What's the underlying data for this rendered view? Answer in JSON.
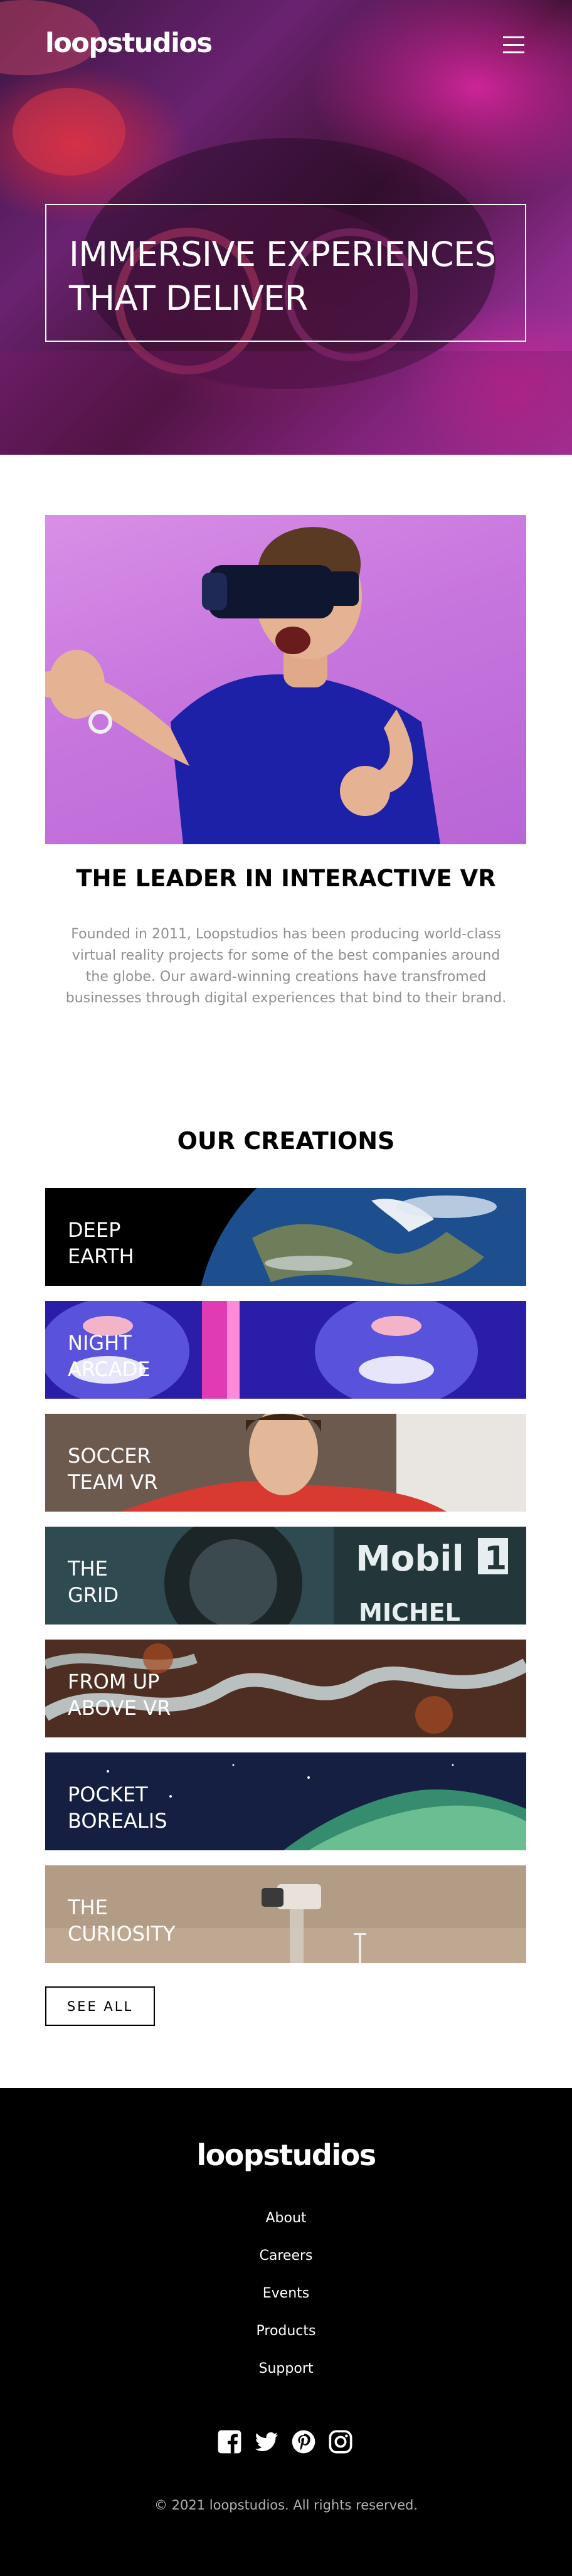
{
  "header": {
    "logo": "loopstudios",
    "menu_icon": "hamburger-menu-icon"
  },
  "hero": {
    "title": "IMMERSIVE EXPERIENCES\nTHAT DELIVER"
  },
  "about": {
    "heading": "THE LEADER IN INTERACTIVE VR",
    "text": "Founded in 2011, Loopstudios has been producing world-class virtual reality projects for some of the best companies around the globe. Our award-winning creations have transfromed businesses through digital experiences that bind to their brand."
  },
  "creations": {
    "heading": "OUR CREATIONS",
    "items": [
      {
        "title": "DEEP\nEARTH"
      },
      {
        "title": "NIGHT\nARCADE"
      },
      {
        "title": "SOCCER\nTEAM VR"
      },
      {
        "title": "THE\nGRID"
      },
      {
        "title": "FROM UP\nABOVE VR"
      },
      {
        "title": "POCKET\nBOREALIS"
      },
      {
        "title": "THE\nCURIOSITY"
      }
    ],
    "see_all": "SEE ALL"
  },
  "footer": {
    "logo": "loopstudios",
    "nav": [
      "About",
      "Careers",
      "Events",
      "Products",
      "Support"
    ],
    "social_icons": [
      "facebook-icon",
      "twitter-icon",
      "pinterest-icon",
      "instagram-icon"
    ],
    "copyright": "© 2021 loopstudios. All rights reserved."
  }
}
